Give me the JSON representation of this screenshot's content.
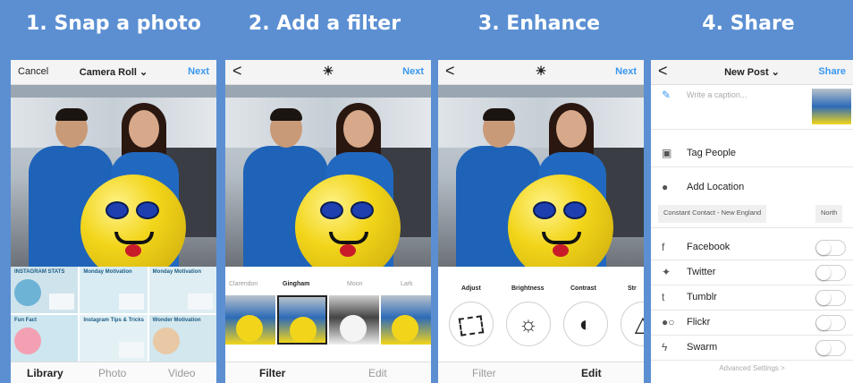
{
  "steps": [
    {
      "title": "1. Snap a photo"
    },
    {
      "title": "2. Add a filter"
    },
    {
      "title": "3. Enhance"
    },
    {
      "title": "4. Share"
    }
  ],
  "panel1": {
    "cancel": "Cancel",
    "title": "Camera Roll ⌄",
    "next": "Next",
    "tabs": [
      "Library",
      "Photo",
      "Video"
    ],
    "tiles": [
      "INSTAGRAM STATS",
      "Monday Motivation",
      "Monday Motivation",
      "Fun Fact",
      "Instagram Tips & Tricks",
      "Wonder Motivation"
    ]
  },
  "panel2": {
    "back": "<",
    "next": "Next",
    "filters": [
      "Clarendon",
      "Gingham",
      "Moon",
      "Lark"
    ],
    "selected_filter": "Gingham",
    "tabs": [
      "Filter",
      "Edit"
    ]
  },
  "panel3": {
    "back": "<",
    "next": "Next",
    "tools": [
      "Adjust",
      "Brightness",
      "Contrast",
      "Str"
    ],
    "tabs": [
      "Filter",
      "Edit"
    ]
  },
  "panel4": {
    "back": "<",
    "title": "New Post ⌄",
    "share": "Share",
    "caption_placeholder": "Write a caption...",
    "tag_people": "Tag People",
    "add_location": "Add Location",
    "location_chips": [
      "Constant Contact - New England",
      "North"
    ],
    "networks": [
      "Facebook",
      "Twitter",
      "Tumblr",
      "Flickr",
      "Swarm"
    ],
    "advanced": "Advanced Settings >"
  },
  "colors": {
    "background": "#5b8fd2",
    "link": "#3897f0"
  }
}
